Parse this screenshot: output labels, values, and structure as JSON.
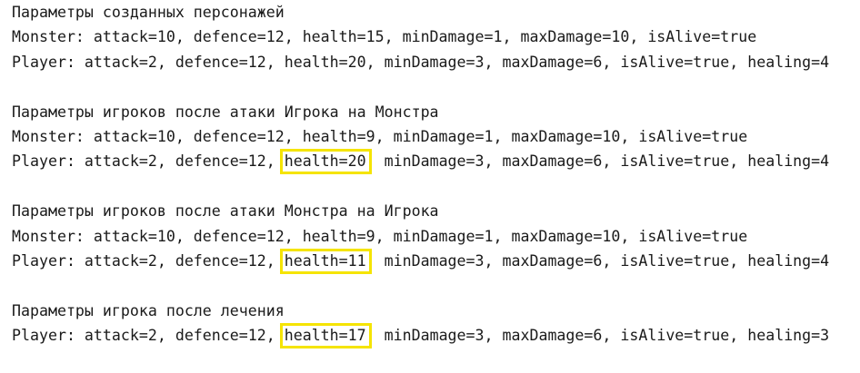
{
  "highlight_color": "#f5e400",
  "sections": [
    {
      "title": "Параметры созданных персонажей",
      "lines": [
        {
          "pre": "Monster: attack=10, defence=12, health=15, minDamage=1, maxDamage=10, isAlive=true",
          "hl": "",
          "post": ""
        },
        {
          "pre": "Player: attack=2, defence=12, health=20, minDamage=3, maxDamage=6, isAlive=true, healing=4",
          "hl": "",
          "post": ""
        }
      ]
    },
    {
      "title": "Параметры игроков после атаки Игрока на Монстра",
      "lines": [
        {
          "pre": "Monster: attack=10, defence=12, health=9, minDamage=1, maxDamage=10, isAlive=true",
          "hl": "",
          "post": ""
        },
        {
          "pre": "Player: attack=2, defence=12, ",
          "hl": "health=20",
          "post": ", minDamage=3, maxDamage=6, isAlive=true, healing=4"
        }
      ]
    },
    {
      "title": "Параметры игроков после атаки Монстра на Игрока",
      "lines": [
        {
          "pre": "Monster: attack=10, defence=12, health=9, minDamage=1, maxDamage=10, isAlive=true",
          "hl": "",
          "post": ""
        },
        {
          "pre": "Player: attack=2, defence=12, ",
          "hl": "health=11",
          "post": ", minDamage=3, maxDamage=6, isAlive=true, healing=4"
        }
      ]
    },
    {
      "title": "Параметры игрока после лечения",
      "lines": [
        {
          "pre": "Player: attack=2, defence=12, ",
          "hl": "health=17",
          "post": ", minDamage=3, maxDamage=6, isAlive=true, healing=3"
        }
      ]
    }
  ]
}
